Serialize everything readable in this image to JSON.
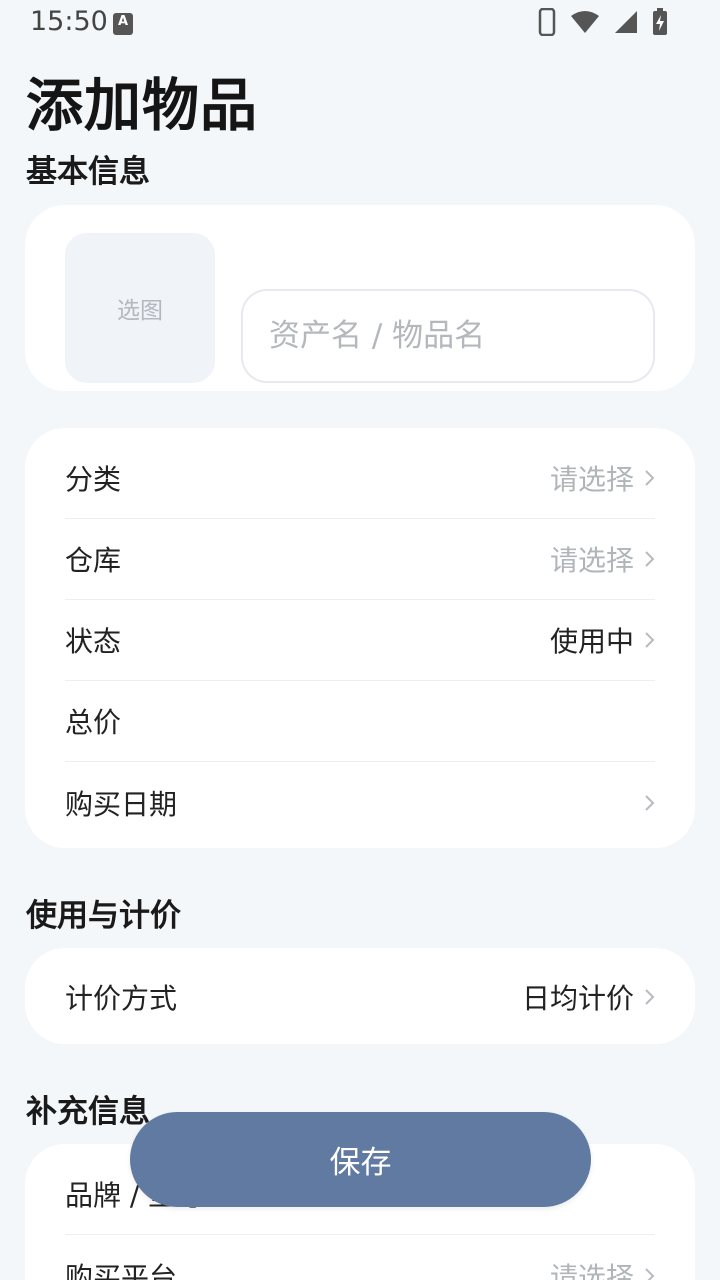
{
  "status_bar": {
    "time": "15:50",
    "a_icon": "A"
  },
  "page": {
    "title": "添加物品"
  },
  "basic_info": {
    "section_title": "基本信息",
    "image_picker_label": "选图",
    "name_placeholder": "资产名 / 物品名",
    "name_value": "",
    "rows": [
      {
        "label": "分类",
        "value": "请选择",
        "is_placeholder": true,
        "has_chevron": true
      },
      {
        "label": "仓库",
        "value": "请选择",
        "is_placeholder": true,
        "has_chevron": true
      },
      {
        "label": "状态",
        "value": "使用中",
        "is_placeholder": false,
        "has_chevron": true
      },
      {
        "label": "总价",
        "value": "",
        "is_placeholder": false,
        "has_chevron": false
      },
      {
        "label": "购买日期",
        "value": "",
        "is_placeholder": false,
        "has_chevron": true
      }
    ]
  },
  "usage_pricing": {
    "section_title": "使用与计价",
    "rows": [
      {
        "label": "计价方式",
        "value": "日均计价",
        "is_placeholder": false,
        "has_chevron": true
      }
    ]
  },
  "extra_info": {
    "section_title": "补充信息",
    "rows": [
      {
        "label": "品牌 / 型号",
        "value": "",
        "is_placeholder": false,
        "has_chevron": false
      },
      {
        "label": "购买平台",
        "value": "请选择",
        "is_placeholder": true,
        "has_chevron": true
      }
    ]
  },
  "save_button_label": "保存",
  "colors": {
    "background": "#f4f7fa",
    "card": "#ffffff",
    "accent": "#607aa1",
    "placeholder_text": "#b1b5ba"
  },
  "icons": [
    "phone-icon",
    "wifi-icon",
    "signal-icon",
    "battery-charging-icon",
    "chevron-right-icon",
    "a-notification-icon"
  ]
}
